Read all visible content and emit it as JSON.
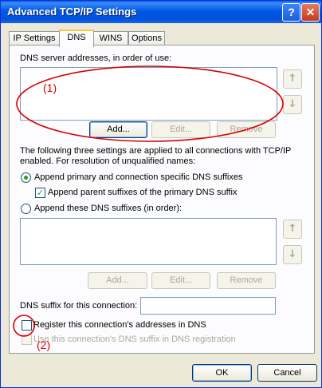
{
  "window": {
    "title": "Advanced TCP/IP Settings",
    "help_glyph": "?",
    "close_glyph": "✕"
  },
  "tabs": [
    {
      "label": "IP Settings",
      "active": false
    },
    {
      "label": "DNS",
      "active": true
    },
    {
      "label": "WINS",
      "active": false
    },
    {
      "label": "Options",
      "active": false
    }
  ],
  "dns_servers": {
    "label": "DNS server addresses, in order of use:",
    "items": [],
    "add_label": "Add...",
    "edit_label": "Edit...",
    "remove_label": "Remove",
    "up_glyph": "↑",
    "down_glyph": "↓"
  },
  "resolution": {
    "description": "The following three settings are applied to all connections with TCP/IP enabled. For resolution of unqualified names:",
    "radio_primary_label": "Append primary and connection specific DNS suffixes",
    "radio_primary_checked": true,
    "check_parent_label": "Append parent suffixes of the primary DNS suffix",
    "check_parent_checked": true,
    "radio_these_label": "Append these DNS suffixes (in order):",
    "radio_these_checked": false,
    "suffix_items": [],
    "add_label": "Add...",
    "edit_label": "Edit...",
    "remove_label": "Remove",
    "up_glyph": "↑",
    "down_glyph": "↓"
  },
  "connection": {
    "suffix_label": "DNS suffix for this connection:",
    "suffix_value": "",
    "register_label": "Register this connection's addresses in DNS",
    "register_checked": false,
    "use_suffix_label": "Use this connection's DNS suffix in DNS registration",
    "use_suffix_checked": false
  },
  "annotations": {
    "one": "(1)",
    "two": "(2)",
    "color": "#d60000"
  },
  "footer": {
    "ok_label": "OK",
    "cancel_label": "Cancel"
  },
  "colors": {
    "titlebar": "#0058e6",
    "dialog_bg": "#ece9d8",
    "panel_bg": "#fcfcfe",
    "accent_check": "#21a121"
  }
}
